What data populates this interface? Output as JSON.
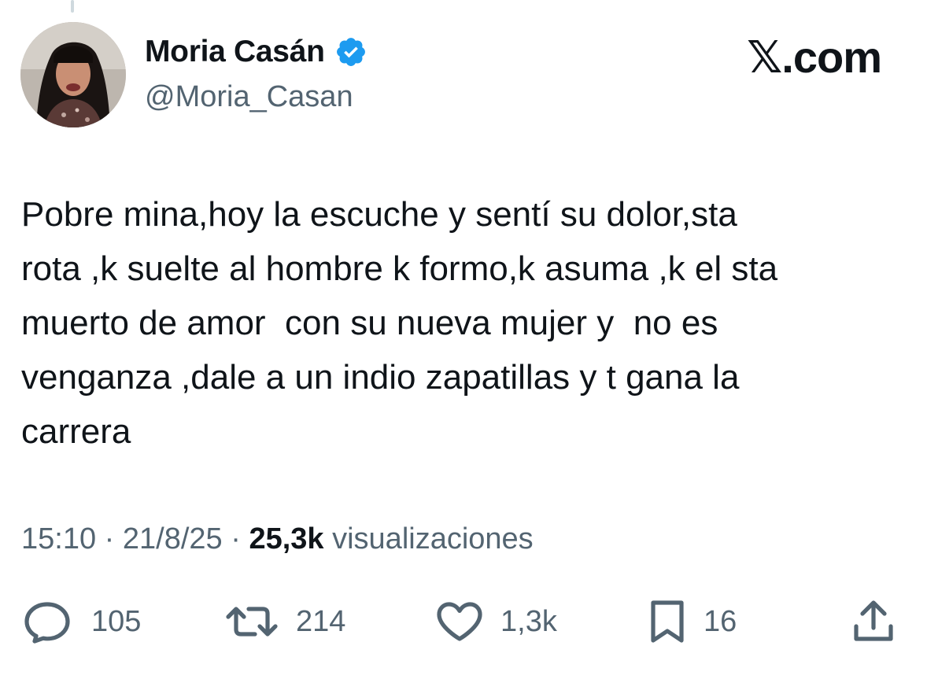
{
  "tweet": {
    "author": {
      "display_name": "Moria Casán",
      "handle": "@Moria_Casan",
      "verified": true,
      "verified_color": "#1d9bf0"
    },
    "brand": "𝕏.com",
    "text": "Pobre mina,hoy la escuche y sentí su dolor,sta\nrota ,k suelte al hombre k formo,k asuma ,k el sta\nmuerto de amor  con su nueva mujer y  no es\nvenganza ,dale a un indio zapatillas y t gana la\ncarrera",
    "time": "15:10",
    "separator": "·",
    "date": "21/8/25",
    "views_count": "25,3k",
    "views_label": "visualizaciones",
    "actions": {
      "replies": "105",
      "reposts": "214",
      "likes": "1,3k",
      "bookmarks": "16"
    },
    "icons": [
      "reply-icon",
      "repost-icon",
      "like-icon",
      "bookmark-icon",
      "share-icon",
      "verified-badge-icon"
    ]
  },
  "colors": {
    "text_primary": "#0f1419",
    "text_secondary": "#536471",
    "accent": "#1d9bf0"
  }
}
